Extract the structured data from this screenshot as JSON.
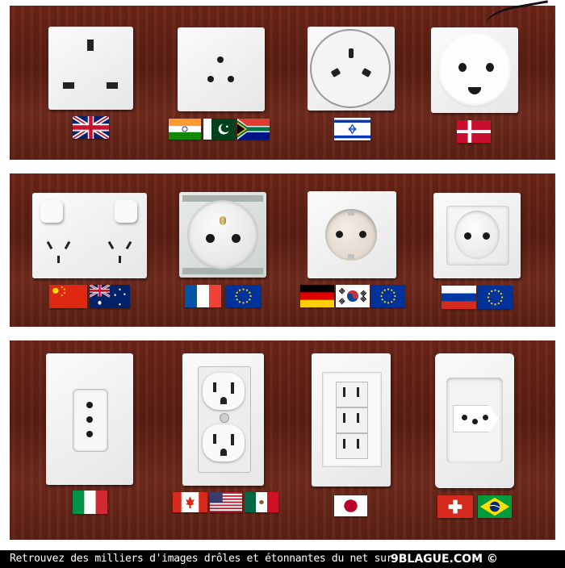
{
  "footer": {
    "text": "Retrouvez des milliers d'images drôles et étonnantes du net sur",
    "brand": "9BLAGUE.COM ©"
  },
  "rows": [
    {
      "sockets": [
        {
          "type": "UK type G",
          "flags": [
            "united-kingdom"
          ]
        },
        {
          "type": "type D",
          "flags": [
            "india",
            "pakistan",
            "south-africa"
          ]
        },
        {
          "type": "Israel type H",
          "flags": [
            "israel"
          ]
        },
        {
          "type": "Denmark type K",
          "flags": [
            "denmark"
          ]
        }
      ]
    },
    {
      "sockets": [
        {
          "type": "double type I",
          "flags": [
            "china",
            "australia"
          ]
        },
        {
          "type": "France type E",
          "flags": [
            "france",
            "european-union"
          ]
        },
        {
          "type": "Schuko type F",
          "flags": [
            "germany",
            "south-korea",
            "european-union"
          ]
        },
        {
          "type": "type C/F",
          "flags": [
            "russia",
            "european-union"
          ]
        }
      ]
    },
    {
      "sockets": [
        {
          "type": "Italy type L",
          "flags": [
            "italy"
          ]
        },
        {
          "type": "duplex type B",
          "flags": [
            "canada",
            "united-states",
            "mexico"
          ]
        },
        {
          "type": "triple type A",
          "flags": [
            "japan"
          ]
        },
        {
          "type": "Switzerland type J / Brazil type N",
          "flags": [
            "switzerland",
            "brazil"
          ]
        }
      ]
    }
  ]
}
